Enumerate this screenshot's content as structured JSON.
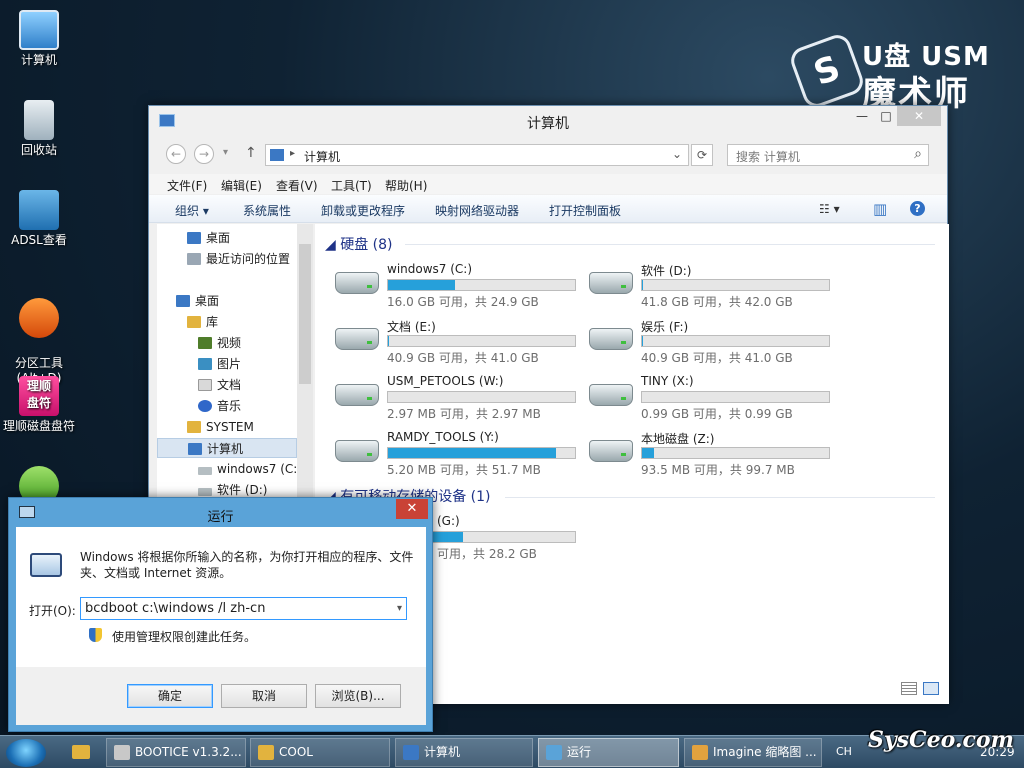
{
  "desktop": {
    "icons": [
      {
        "label": "计算机"
      },
      {
        "label": "回收站"
      },
      {
        "label": "ADSL查看"
      },
      {
        "label": "分区工具\n(Alt+D)"
      },
      {
        "label": "理顺磁盘盘符",
        "glyph_text": "理顺\n盘符"
      },
      {
        "label": ""
      }
    ]
  },
  "brand": {
    "badge": "S",
    "line1": "U盘 USM",
    "line2": "魔术师"
  },
  "explorer": {
    "title": "计算机",
    "controls": {
      "minimize": "—",
      "maximize": "□",
      "close": "✕"
    },
    "nav": {
      "back": "←",
      "forward": "→",
      "recent": "▾",
      "up": "↑"
    },
    "address": {
      "sep": "▸",
      "path": "计算机",
      "dropdown": "⌄",
      "refresh": "⟳"
    },
    "search": {
      "placeholder": "搜索 计算机",
      "icon": "⌕"
    },
    "menu": [
      "文件(F)",
      "编辑(E)",
      "查看(V)",
      "工具(T)",
      "帮助(H)"
    ],
    "toolbar": [
      "组织 ▾",
      "系统属性",
      "卸载或更改程序",
      "映射网络驱动器",
      "打开控制面板"
    ],
    "toolbar_right": {
      "view": "☷ ▾",
      "pane": "▥",
      "help": "?"
    },
    "navpane": [
      {
        "label": "桌面",
        "indent": 2,
        "color": "#3b78c4"
      },
      {
        "label": "最近访问的位置",
        "indent": 2,
        "color": "#9aa7b4"
      },
      {
        "label": "桌面",
        "indent": 1,
        "color": "#3b78c4"
      },
      {
        "label": "库",
        "indent": 2,
        "color": "#e2b33e"
      },
      {
        "label": "视频",
        "indent": 3,
        "color": "#4f7d2a"
      },
      {
        "label": "图片",
        "indent": 3,
        "color": "#3a8fc2"
      },
      {
        "label": "文档",
        "indent": 3,
        "color": "#d9d9d9"
      },
      {
        "label": "音乐",
        "indent": 3,
        "color": "#2f67c9"
      },
      {
        "label": "SYSTEM",
        "indent": 2,
        "color": "#e2b33e"
      },
      {
        "label": "计算机",
        "indent": 2,
        "color": "#3b78c4"
      },
      {
        "label": "windows7 (C:)",
        "indent": 3,
        "color": "#b5bec2"
      },
      {
        "label": "软件 (D:)",
        "indent": 3,
        "color": "#b5bec2"
      }
    ],
    "groups": {
      "hdd": "◢ 硬盘 (8)",
      "removable": "◢ 有可移动存储的设备 (1)"
    },
    "drives": [
      {
        "name": "windows7 (C:)",
        "info": "16.0 GB 可用，共 24.9 GB",
        "used_fraction": 0.357
      },
      {
        "name": "软件 (D:)",
        "info": "41.8 GB 可用，共 42.0 GB",
        "used_fraction": 0.005
      },
      {
        "name": "文档 (E:)",
        "info": "40.9 GB 可用，共 41.0 GB",
        "used_fraction": 0.003
      },
      {
        "name": "娱乐 (F:)",
        "info": "40.9 GB 可用，共 41.0 GB",
        "used_fraction": 0.003
      },
      {
        "name": "USM_PETOOLS (W:)",
        "info": "2.97 MB 可用，共 2.97 MB",
        "used_fraction": 0.0
      },
      {
        "name": "TINY (X:)",
        "info": "0.99 GB 可用，共 0.99 GB",
        "used_fraction": 0.0
      },
      {
        "name": "RAMDY_TOOLS (Y:)",
        "info": "5.20 MB 可用，共 51.7 MB",
        "used_fraction": 0.9
      },
      {
        "name": "本地磁盘 (Z:)",
        "info": "93.5 MB 可用，共 99.7 MB",
        "used_fraction": 0.062
      }
    ],
    "removable_drive": {
      "name": "(G:)",
      "info": "可用，共 28.2 GB",
      "used_fraction": 0.4
    }
  },
  "run": {
    "title": "运行",
    "close": "✕",
    "description": "Windows 将根据你所输入的名称，为你打开相应的程序、文件夹、文档或 Internet 资源。",
    "open_label": "打开(O):",
    "command": "bcdboot c:\\windows /l zh-cn",
    "dropdown": "▾",
    "admin_text": "使用管理权限创建此任务。",
    "ok": "确定",
    "cancel": "取消",
    "browse": "浏览(B)..."
  },
  "taskbar": {
    "items": [
      {
        "label": "BOOTICE v1.3.2...",
        "color": "#c8c8c8"
      },
      {
        "label": "COOL",
        "color": "#e2b33e"
      },
      {
        "label": "计算机",
        "color": "#3b78c4"
      },
      {
        "label": "运行",
        "color": "#5aa3d8",
        "active": true
      },
      {
        "label": "Imagine 缩略图 ...",
        "color": "#e2a23e"
      }
    ],
    "ime": "CH",
    "clock": "20:29"
  },
  "watermark": "SysCeo.com"
}
